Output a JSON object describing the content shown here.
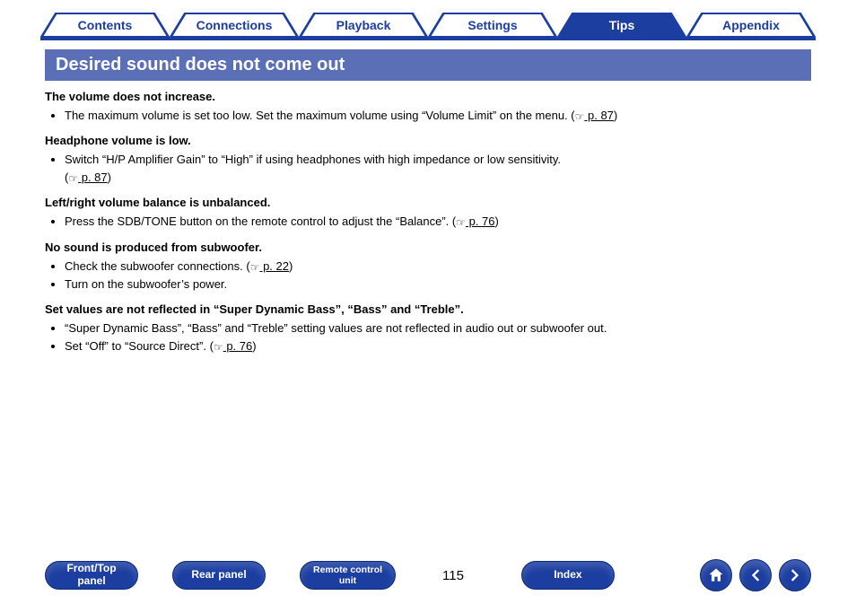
{
  "nav": {
    "tabs": [
      "Contents",
      "Connections",
      "Playback",
      "Settings",
      "Tips",
      "Appendix"
    ],
    "active_index": 4
  },
  "section_title": "Desired sound does not come out",
  "troubles": [
    {
      "heading": "The volume does not increase.",
      "items": [
        {
          "text": "The maximum volume is set too low. Set the maximum volume using “Volume Limit” on the menu.  ",
          "ref": "p. 87"
        }
      ]
    },
    {
      "heading": "Headphone volume is low.",
      "items": [
        {
          "text": "Switch “H/P Amplifier Gain” to “High” if using headphones with high impedance or low sensitivity.",
          "ref": "p. 87",
          "ref_newline": true
        }
      ]
    },
    {
      "heading": "Left/right volume balance is unbalanced.",
      "items": [
        {
          "text": "Press the SDB/TONE button on the remote control to adjust the “Balance”.  ",
          "ref": "p. 76"
        }
      ]
    },
    {
      "heading": "No sound is produced from subwoofer.",
      "items": [
        {
          "text": "Check the subwoofer connections.  ",
          "ref": "p. 22"
        },
        {
          "text": "Turn on the subwoofer’s power."
        }
      ]
    },
    {
      "heading": "Set values are not reflected in “Super Dynamic Bass”, “Bass” and “Treble”.",
      "items": [
        {
          "text": "“Super Dynamic Bass”, “Bass” and “Treble” setting values are not reflected in audio out or subwoofer out."
        },
        {
          "text": "Set “Off” to “Source Direct”.  ",
          "ref": "p. 76"
        }
      ]
    }
  ],
  "bottom": {
    "buttons": [
      {
        "line1": "Front/Top",
        "line2": "panel"
      },
      {
        "line1": "Rear panel"
      },
      {
        "line1": "Remote control",
        "line2": "unit",
        "small": true
      },
      {
        "line1": "Index"
      }
    ],
    "page_number": "115",
    "round_buttons": [
      "home",
      "prev",
      "next"
    ]
  }
}
